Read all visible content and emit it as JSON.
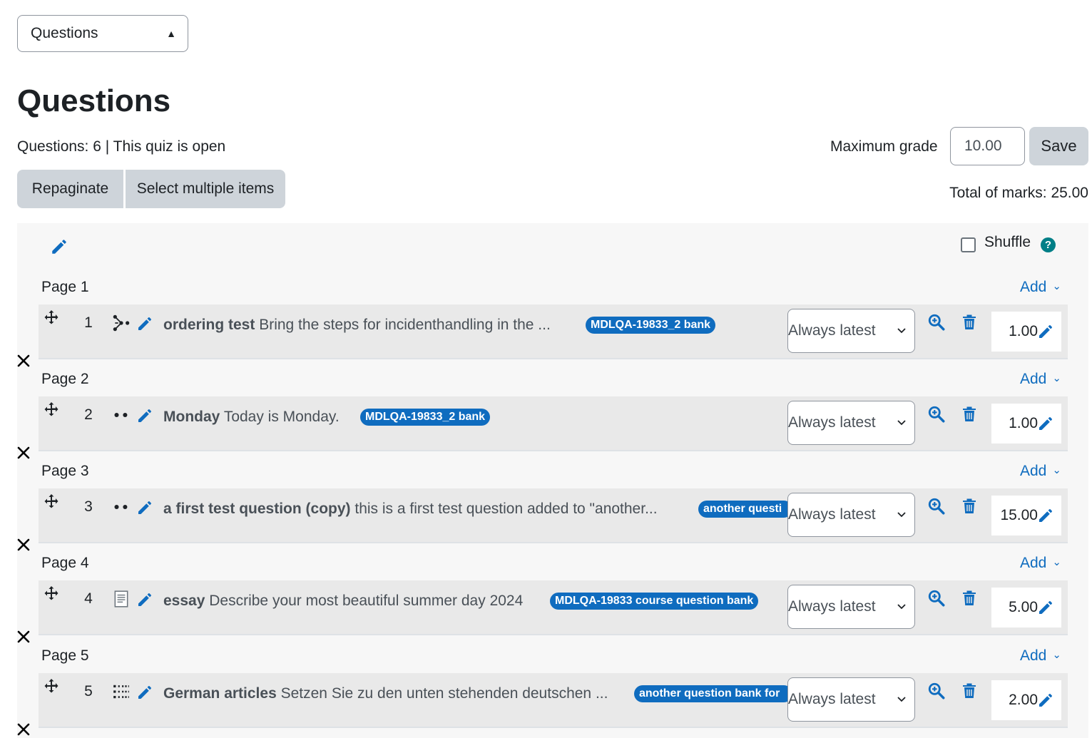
{
  "nav_select": {
    "value": "Questions"
  },
  "page_title": "Questions",
  "status_line": "Questions: 6 | This quiz is open",
  "max_grade": {
    "label": "Maximum grade",
    "value": "10.00",
    "save_label": "Save"
  },
  "toolbar": {
    "repaginate_label": "Repaginate",
    "select_multiple_label": "Select multiple items"
  },
  "total_marks": "Total of marks: 25.00",
  "shuffle": {
    "label": "Shuffle",
    "help_glyph": "?"
  },
  "add_label": "Add",
  "pages": [
    {
      "label": "Page 1",
      "slot": {
        "number": "1",
        "type_icon": "ordering-icon",
        "name": "ordering test",
        "text": "Bring the steps for incidenthandling in the ...",
        "badge": "MDLQA-19833_2 bank",
        "version": "Always latest",
        "mark": "1.00"
      }
    },
    {
      "label": "Page 2",
      "slot": {
        "number": "2",
        "type_icon": "true-false-icon",
        "name": "Monday",
        "text": "Today is Monday.",
        "badge": "MDLQA-19833_2 bank",
        "version": "Always latest",
        "mark": "1.00"
      }
    },
    {
      "label": "Page 3",
      "slot": {
        "number": "3",
        "type_icon": "true-false-icon",
        "name": "a first test question (copy)",
        "text": "this is a first test question added to \"another...",
        "badge": "another questi",
        "version": "Always latest",
        "mark": "15.00"
      }
    },
    {
      "label": "Page 4",
      "slot": {
        "number": "4",
        "type_icon": "essay-icon",
        "name": "essay",
        "text": "Describe your most beautiful summer day 2024",
        "badge": "MDLQA-19833 course question bank",
        "version": "Always latest",
        "mark": "5.00"
      }
    },
    {
      "label": "Page 5",
      "slot": {
        "number": "5",
        "type_icon": "matching-icon",
        "name": "German articles",
        "text": "Setzen Sie zu den unten stehenden deutschen ...",
        "badge": "another question bank for",
        "version": "Always latest",
        "mark": "2.00"
      }
    }
  ],
  "colors": {
    "link": "#0f6cbf",
    "badge": "#0f6cbf",
    "help": "#007f87",
    "button": "#ced4da",
    "slot_bg": "#e9e9e9"
  }
}
